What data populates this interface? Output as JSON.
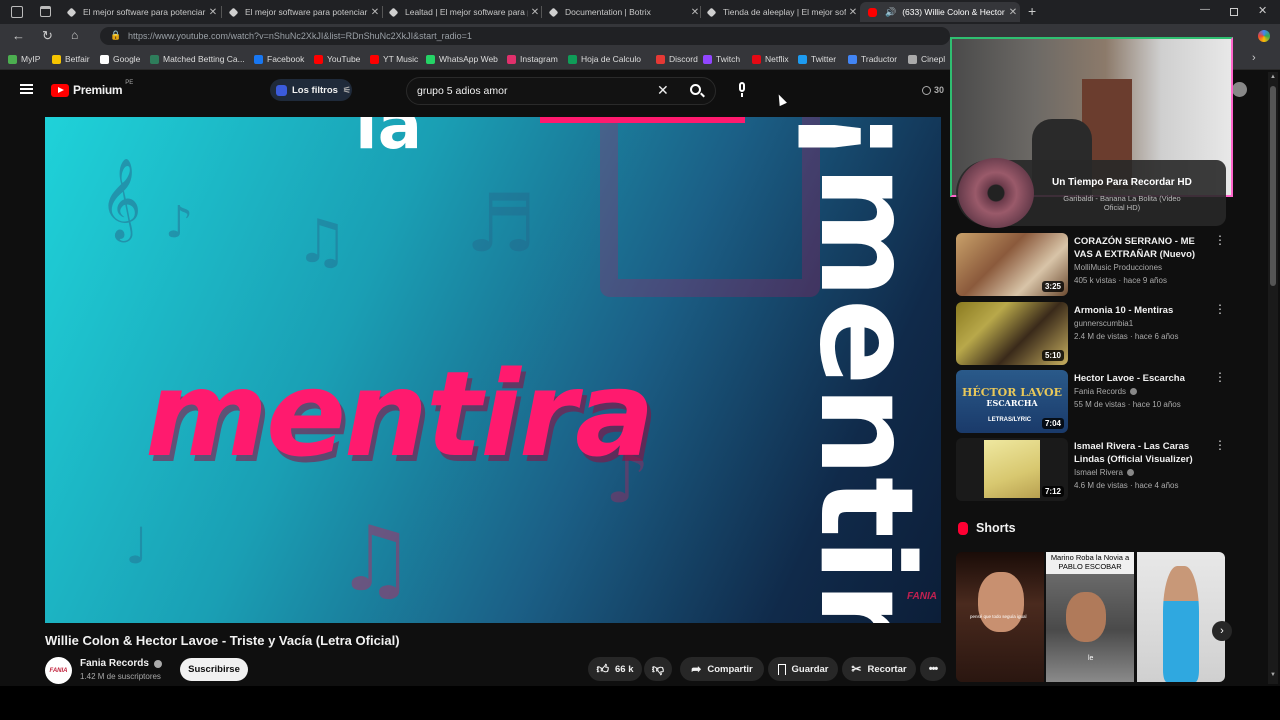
{
  "browser": {
    "tabs": [
      {
        "label": "El mejor software para potenciar",
        "active": false
      },
      {
        "label": "El mejor software para potenciar",
        "active": false
      },
      {
        "label": "Lealtad | El mejor software para p",
        "active": false
      },
      {
        "label": "Documentation | Botrix",
        "active": false
      },
      {
        "label": "Tienda de aleeplay | El mejor soft",
        "active": false
      },
      {
        "label": "(633) Willie Colon & Hector",
        "active": true
      }
    ],
    "url": "https://www.youtube.com/watch?v=nShuNc2XkJI&list=RDnShuNc2XkJI&start_radio=1",
    "bookmarks": [
      {
        "label": "MyIP",
        "color": "#4caf50"
      },
      {
        "label": "Betfair",
        "color": "#f5c400"
      },
      {
        "label": "Google",
        "color": "#ffffff"
      },
      {
        "label": "Matched Betting Ca...",
        "color": "#2e7d5b"
      },
      {
        "label": "Facebook",
        "color": "#1877f2"
      },
      {
        "label": "YouTube",
        "color": "#ff0000"
      },
      {
        "label": "YT Music",
        "color": "#ff0000"
      },
      {
        "label": "WhatsApp Web",
        "color": "#25d366"
      },
      {
        "label": "Instagram",
        "color": "#e1306c"
      },
      {
        "label": "Hoja de Calculo",
        "color": "#0f9d58"
      },
      {
        "label": "Discord",
        "color": "#e53935"
      },
      {
        "label": "Twitch",
        "color": "#9146ff"
      },
      {
        "label": "Netflix",
        "color": "#e50914"
      },
      {
        "label": "Twitter",
        "color": "#1d9bf0"
      },
      {
        "label": "Traductor",
        "color": "#4285f4"
      },
      {
        "label": "Cinepl",
        "color": "#aaaaaa"
      }
    ]
  },
  "youtube": {
    "logo_text": "Premium",
    "region": "PE",
    "filter_label": "Los filtros",
    "search_value": "grupo 5 adios amor",
    "counter_partial": "30"
  },
  "video": {
    "overlay_word": "mentira",
    "side_word": "¡mentira!",
    "brand": "FANIA",
    "title": "Willie Colon & Hector Lavoe - Triste y Vacía (Letra Oficial)"
  },
  "channel": {
    "name": "Fania Records",
    "subscribers": "1.42 M de suscriptores",
    "subscribe_label": "Suscribirse",
    "avatar_text": "FANIA"
  },
  "actions": {
    "likes": "66 k",
    "share": "Compartir",
    "save": "Guardar",
    "clip": "Recortar"
  },
  "now_playing": {
    "title": "Un Tiempo Para Recordar HD",
    "subtitle": "Garibaldi - Banana La Bolita (Video Oficial HD)"
  },
  "related": [
    {
      "title": "CORAZÓN SERRANO - ME VAS A EXTRAÑAR (Nuevo)",
      "channel": "MolliMusic Producciones",
      "meta": "405 k vistas · hace 9 años",
      "duration": "3:25",
      "verified": false
    },
    {
      "title": "Armonia 10 - Mentiras",
      "channel": "gunnerscumbia1",
      "meta": "2.4 M de vistas · hace 6 años",
      "duration": "5:10",
      "verified": false
    },
    {
      "title": "Hector Lavoe - Escarcha",
      "channel": "Fania Records",
      "meta": "55 M de vistas · hace 10 años",
      "duration": "7:04",
      "verified": true,
      "thumb_line1": "HÉCTOR LAVOE",
      "thumb_line2": "ESCARCHA",
      "thumb_line3": "LETRAS/LYRIC"
    },
    {
      "title": "Ismael Rivera - Las Caras Lindas (Official Visualizer)",
      "channel": "Ismael Rivera",
      "meta": "4.6 M de vistas · hace 4 años",
      "duration": "7:12",
      "verified": true
    }
  ],
  "shorts": {
    "heading": "Shorts",
    "short2_caption": "Marino Roba la Novia a PABLO ESCOBAR",
    "short1_caption": "pensé que todo seguía igual",
    "short2_sub": "le"
  },
  "colors": {
    "accent_red": "#ff0033",
    "overlay_pink": "#ff1a6e",
    "webcam_frame": "#ff66cc"
  }
}
